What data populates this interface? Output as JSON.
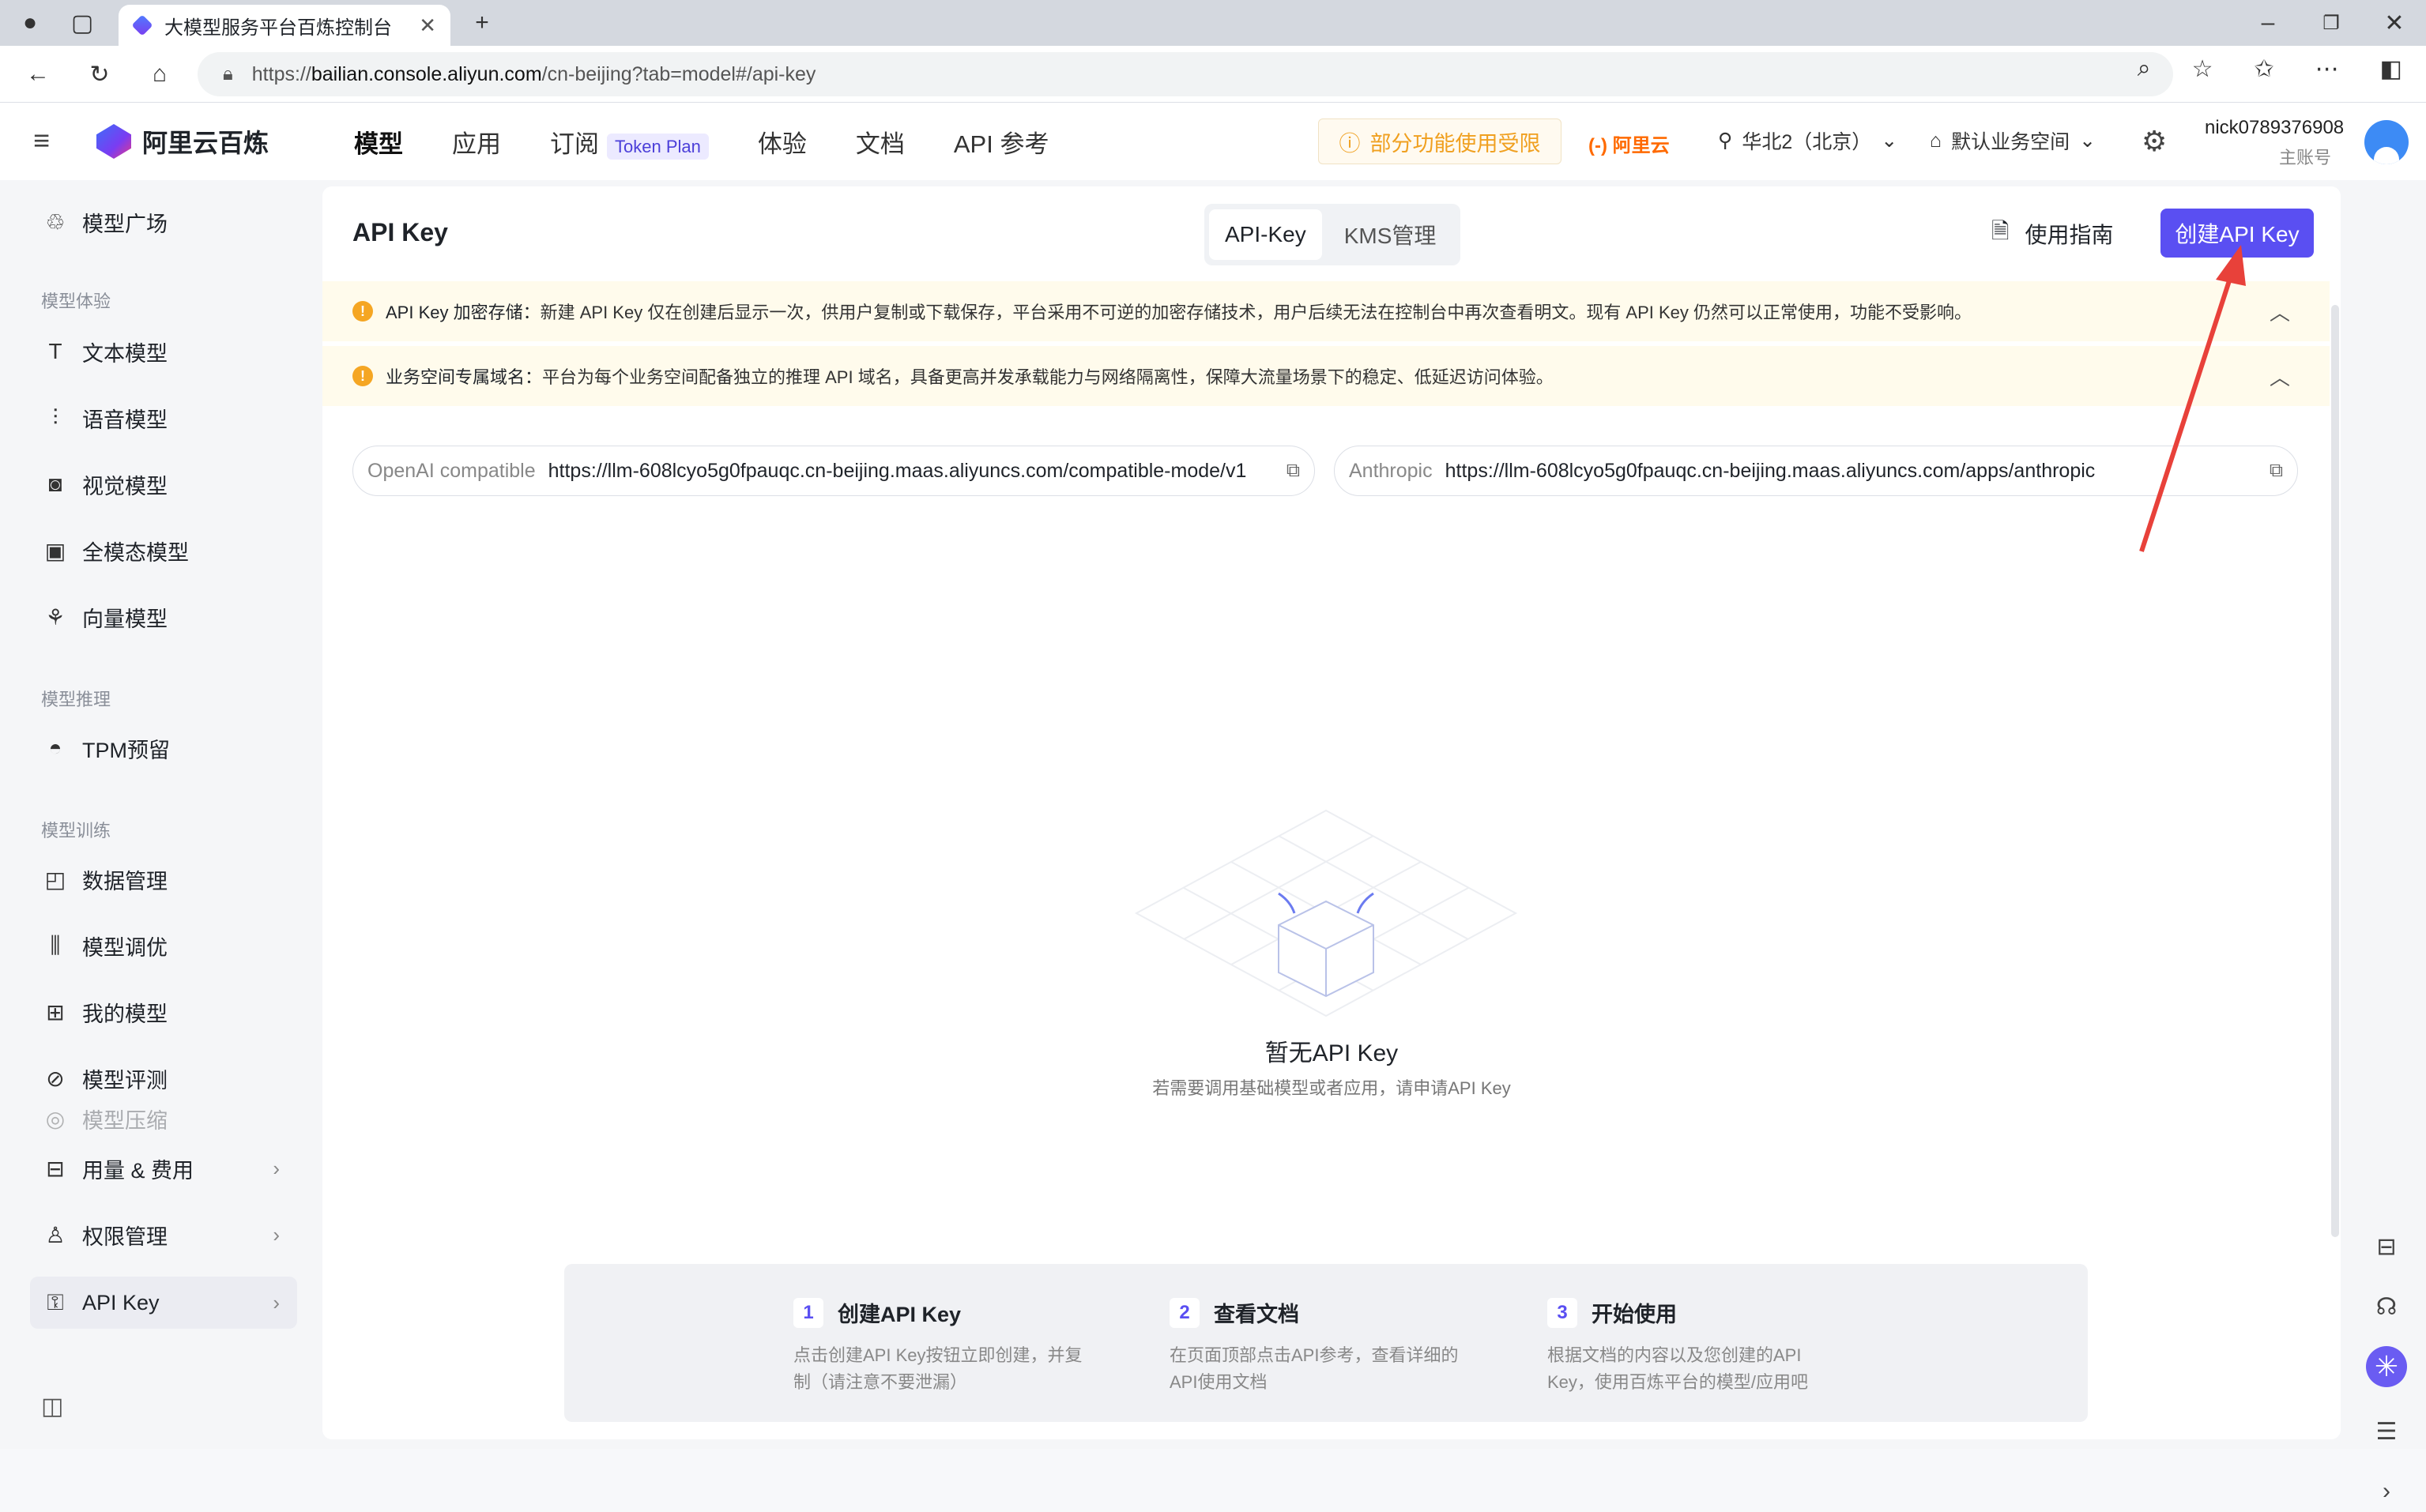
{
  "browser": {
    "tab_title": "大模型服务平台百炼控制台",
    "url_prefix": "https://",
    "url_host": "bailian.console.aliyun.com",
    "url_path": "/cn-beijing?tab=model#/api-key"
  },
  "header": {
    "brand": "阿里云百炼",
    "nav": [
      "模型",
      "应用",
      "订阅",
      "体验",
      "文档",
      "API 参考"
    ],
    "token_badge": "Token Plan",
    "limit_notice": "部分功能使用受限",
    "aliyun": "阿里云",
    "region": "华北2（北京）",
    "workspace": "默认业务空间",
    "user_name": "nick0789376908",
    "user_role": "主账号"
  },
  "sidebar": {
    "top_item": "模型广场",
    "group_experience": "模型体验",
    "experience_items": [
      "文本模型",
      "语音模型",
      "视觉模型",
      "全模态模型",
      "向量模型"
    ],
    "group_inference": "模型推理",
    "inference_items": [
      "TPM预留"
    ],
    "group_training": "模型训练",
    "training_items": [
      "数据管理",
      "模型调优",
      "我的模型",
      "模型评测",
      "模型压缩"
    ],
    "usage": "用量 & 费用",
    "permissions": "权限管理",
    "api_key": "API Key"
  },
  "page": {
    "title": "API Key",
    "tab_api_key": "API-Key",
    "tab_kms": "KMS管理",
    "guide": "使用指南",
    "create_button": "创建API Key",
    "notice1_title": "API Key 加密存储：",
    "notice1_text": "新建 API Key 仅在创建后显示一次，供用户复制或下载保存，平台采用不可逆的加密存储技术，用户后续无法在控制台中再次查看明文。现有 API Key 仍然可以正常使用，功能不受影响。",
    "notice2_title": "业务空间专属域名：",
    "notice2_text": "平台为每个业务空间配备独立的推理 API 域名，具备更高并发承载能力与网络隔离性，保障大流量场景下的稳定、低延迟访问体验。",
    "endpoint_openai_label": "OpenAI compatible",
    "endpoint_openai_url": "https://llm-608lcyo5g0fpauqc.cn-beijing.maas.aliyuncs.com/compatible-mode/v1",
    "endpoint_anthropic_label": "Anthropic",
    "endpoint_anthropic_url": "https://llm-608lcyo5g0fpauqc.cn-beijing.maas.aliyuncs.com/apps/anthropic",
    "empty_title": "暂无API Key",
    "empty_sub": "若需要调用基础模型或者应用，请申请API Key"
  },
  "steps": [
    {
      "num": "1",
      "title": "创建API Key",
      "line1": "点击创建API Key按钮立即创建，并复",
      "line2": "制（请注意不要泄漏）"
    },
    {
      "num": "2",
      "title": "查看文档",
      "line1": "在页面顶部点击API参考，查看详细的",
      "line2": "API使用文档"
    },
    {
      "num": "3",
      "title": "开始使用",
      "line1": "根据文档的内容以及您创建的API",
      "line2": "Key，使用百炼平台的模型/应用吧"
    }
  ],
  "colors": {
    "accent": "#5a4ff2",
    "warning": "#f5a623",
    "annotation": "#e8413a"
  }
}
